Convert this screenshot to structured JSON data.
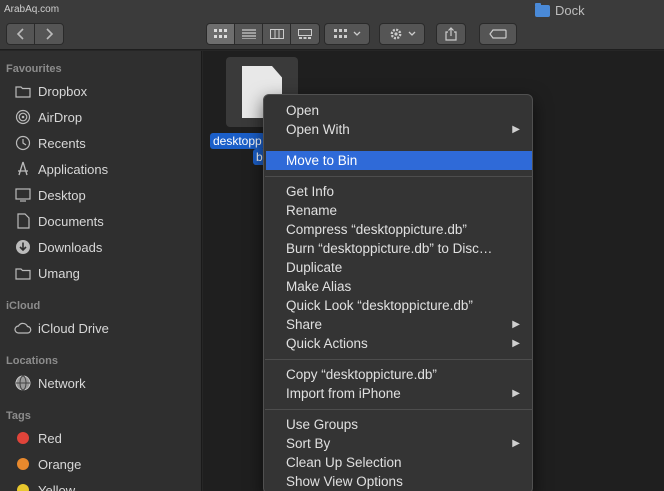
{
  "watermark": "ArabAq.com",
  "window": {
    "title": "Dock"
  },
  "sidebar": {
    "favourites_header": "Favourites",
    "favourites": [
      {
        "label": "Dropbox",
        "icon": "folder-icon"
      },
      {
        "label": "AirDrop",
        "icon": "airdrop-icon"
      },
      {
        "label": "Recents",
        "icon": "clock-icon"
      },
      {
        "label": "Applications",
        "icon": "applications-icon"
      },
      {
        "label": "Desktop",
        "icon": "desktop-icon"
      },
      {
        "label": "Documents",
        "icon": "document-icon"
      },
      {
        "label": "Downloads",
        "icon": "download-icon"
      },
      {
        "label": "Umang",
        "icon": "folder-icon"
      }
    ],
    "icloud_header": "iCloud",
    "icloud": [
      {
        "label": "iCloud Drive",
        "icon": "cloud-icon"
      }
    ],
    "locations_header": "Locations",
    "locations": [
      {
        "label": "Network",
        "icon": "globe-icon"
      }
    ],
    "tags_header": "Tags",
    "tags": [
      {
        "label": "Red",
        "color": "#e0443a"
      },
      {
        "label": "Orange",
        "color": "#e8892d"
      },
      {
        "label": "Yellow",
        "color": "#e8c72d"
      }
    ]
  },
  "file": {
    "name_line1": "desktopp",
    "name_line2": "b"
  },
  "menu": {
    "items": [
      {
        "label": "Open",
        "submenu": false
      },
      {
        "label": "Open With",
        "submenu": true
      },
      {
        "label": "Move to Bin",
        "submenu": false,
        "highlighted": true
      },
      {
        "label": "Get Info",
        "submenu": false
      },
      {
        "label": "Rename",
        "submenu": false
      },
      {
        "label": "Compress “desktoppicture.db”",
        "submenu": false
      },
      {
        "label": "Burn “desktoppicture.db” to Disc…",
        "submenu": false
      },
      {
        "label": "Duplicate",
        "submenu": false
      },
      {
        "label": "Make Alias",
        "submenu": false
      },
      {
        "label": "Quick Look “desktoppicture.db”",
        "submenu": false
      },
      {
        "label": "Share",
        "submenu": true
      },
      {
        "label": "Quick Actions",
        "submenu": true
      },
      {
        "label": "Copy “desktoppicture.db”",
        "submenu": false
      },
      {
        "label": "Import from iPhone",
        "submenu": true
      },
      {
        "label": "Use Groups",
        "submenu": false
      },
      {
        "label": "Sort By",
        "submenu": true
      },
      {
        "label": "Clean Up Selection",
        "submenu": false
      },
      {
        "label": "Show View Options",
        "submenu": false
      }
    ],
    "submenu_arrow": "▶"
  }
}
